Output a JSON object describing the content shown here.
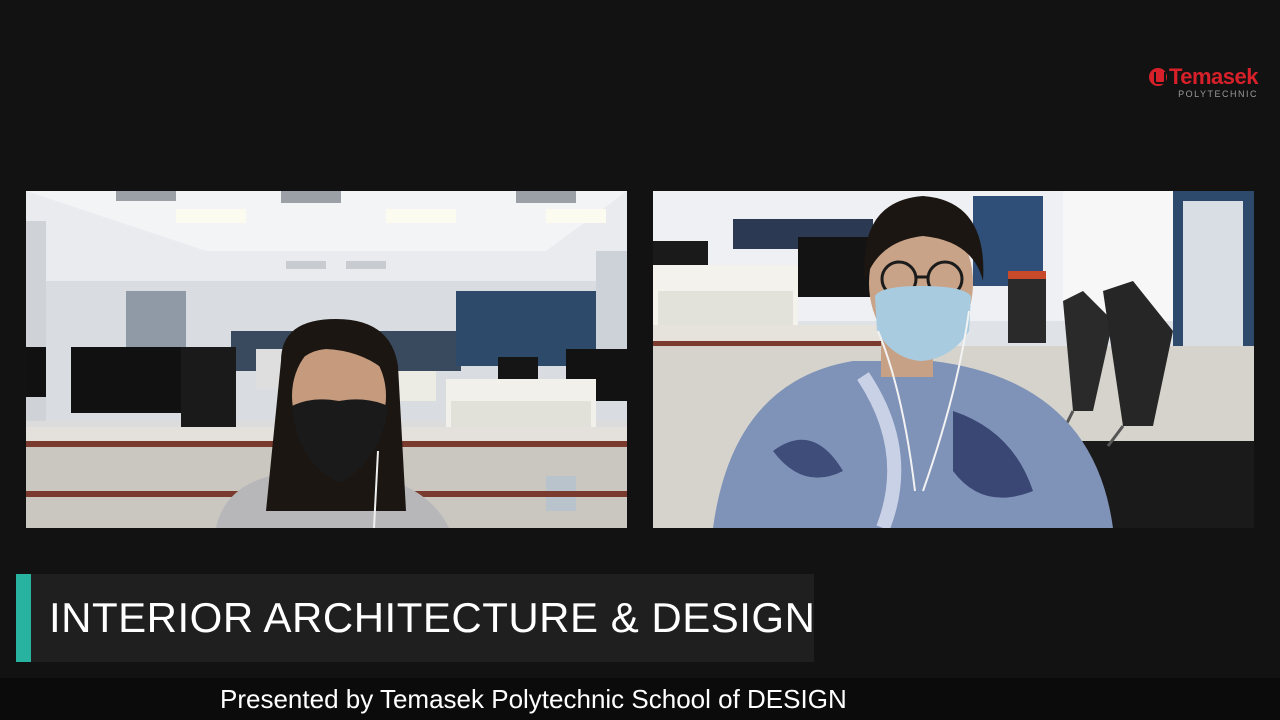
{
  "branding": {
    "logo_name": "Temasek",
    "logo_sub": "POLYTECHNIC",
    "brand_color": "#d8202a"
  },
  "participants": [
    {
      "name": "participant-left",
      "mask_color": "#1a1a1a"
    },
    {
      "name": "participant-right",
      "mask_color": "#a9cbe0"
    }
  ],
  "lower_third": {
    "title": "INTERIOR ARCHITECTURE & DESIGN",
    "accent_color": "#27b3a0"
  },
  "footer": {
    "text": "Presented by Temasek Polytechnic School of DESIGN"
  }
}
